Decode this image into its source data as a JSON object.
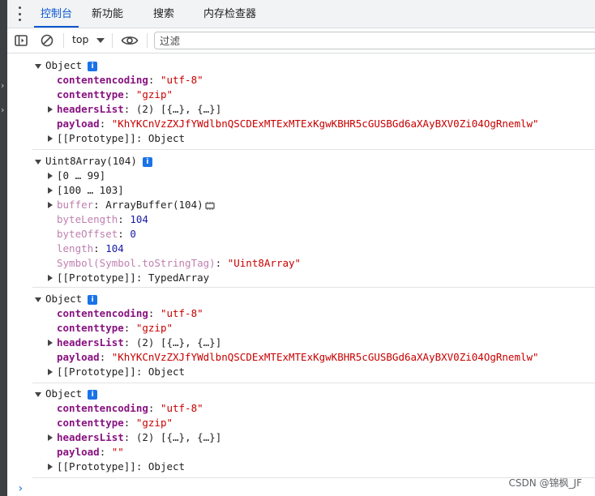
{
  "tabs": [
    {
      "label": "控制台",
      "active": true
    },
    {
      "label": "新功能",
      "active": false
    },
    {
      "label": "搜索",
      "active": false
    },
    {
      "label": "内存检查器",
      "active": false
    }
  ],
  "toolbar": {
    "context": "top",
    "filter_placeholder": "过滤",
    "icons": [
      "sidebar-toggle-icon",
      "clear-console-icon",
      "eye-icon"
    ]
  },
  "colors": {
    "accent": "#0b57d0",
    "key": "#881280",
    "string": "#c80000",
    "number": "#1a1aa6",
    "info_badge": "#1a73e8"
  },
  "entries": [
    {
      "header": "Object",
      "badge": "i",
      "props": [
        {
          "key": "contentencoding",
          "value": "\"utf-8\""
        },
        {
          "key": "contenttype",
          "value": "\"gzip\""
        },
        {
          "key": "headersList",
          "value": "(2) [{…}, {…}]"
        },
        {
          "key": "payload",
          "value": "\"KhYKCnVzZXJfYWdlbnQSCDExMTExMTExKgwKBHR5cGUSBGd6aXAyBXV0Zi04OgRnemlw\""
        },
        {
          "key": "[[Prototype]]",
          "value": "Object"
        }
      ]
    },
    {
      "header": "Uint8Array(104)",
      "badge": "i",
      "props": [
        {
          "key": "[0 … 99]"
        },
        {
          "key": "[100 … 103]"
        },
        {
          "key": "buffer",
          "value": "ArrayBuffer(104)"
        },
        {
          "key": "byteLength",
          "value": "104"
        },
        {
          "key": "byteOffset",
          "value": "0"
        },
        {
          "key": "length",
          "value": "104"
        },
        {
          "key": "Symbol(Symbol.toStringTag)",
          "value": "\"Uint8Array\""
        },
        {
          "key": "[[Prototype]]",
          "value": "TypedArray"
        }
      ]
    },
    {
      "header": "Object",
      "badge": "i",
      "props": [
        {
          "key": "contentencoding",
          "value": "\"utf-8\""
        },
        {
          "key": "contenttype",
          "value": "\"gzip\""
        },
        {
          "key": "headersList",
          "value": "(2) [{…}, {…}]"
        },
        {
          "key": "payload",
          "value": "\"KhYKCnVzZXJfYWdlbnQSCDExMTExMTExKgwKBHR5cGUSBGd6aXAyBXV0Zi04OgRnemlw\""
        },
        {
          "key": "[[Prototype]]",
          "value": "Object"
        }
      ]
    },
    {
      "header": "Object",
      "badge": "i",
      "props": [
        {
          "key": "contentencoding",
          "value": "\"utf-8\""
        },
        {
          "key": "contenttype",
          "value": "\"gzip\""
        },
        {
          "key": "headersList",
          "value": "(2) [{…}, {…}]"
        },
        {
          "key": "payload",
          "value": "\"\""
        },
        {
          "key": "[[Prototype]]",
          "value": "Object"
        }
      ]
    }
  ],
  "prompt": "›",
  "watermark": "CSDN @锦枫_JF"
}
